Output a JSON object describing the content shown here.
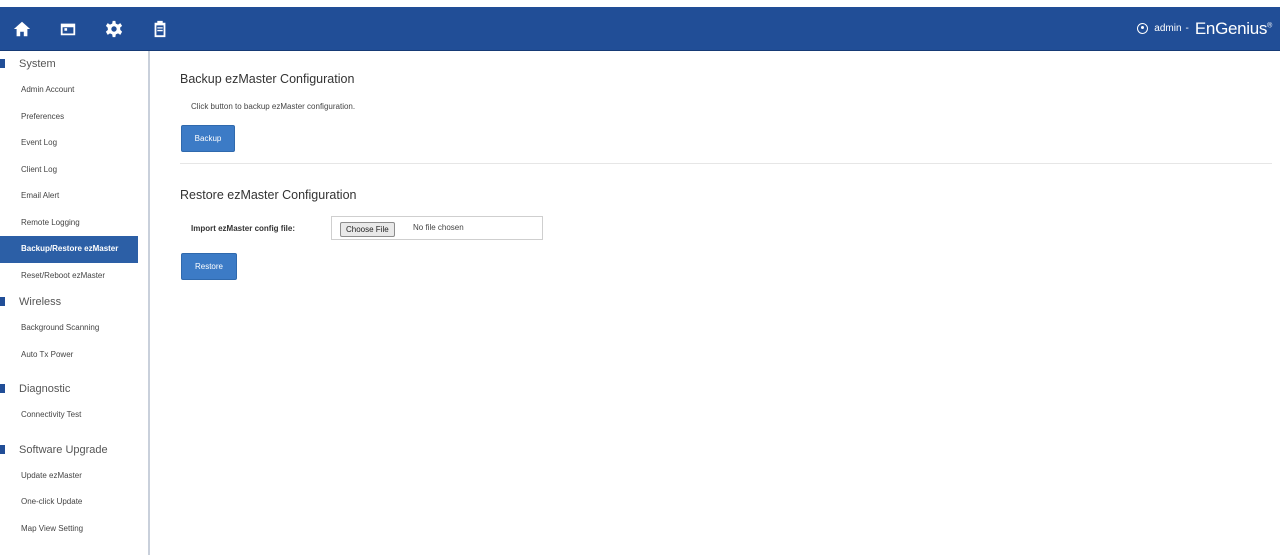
{
  "topbar": {
    "icons": [
      "home-icon",
      "calendar-icon",
      "gear-icon",
      "clipboard-icon"
    ],
    "user": "admin",
    "separator": "-",
    "brand": "EnGenius",
    "brand_mark": "®"
  },
  "sidebar": {
    "sections": [
      {
        "label": "System",
        "items": [
          "Admin Account",
          "Preferences",
          "Event Log",
          "Client Log",
          "Email Alert",
          "Remote Logging",
          "Backup/Restore ezMaster",
          "Reset/Reboot ezMaster"
        ]
      },
      {
        "label": "Wireless",
        "items": [
          "Background Scanning",
          "Auto Tx Power"
        ]
      },
      {
        "label": "Diagnostic",
        "items": [
          "Connectivity Test"
        ]
      },
      {
        "label": "Software Upgrade",
        "items": [
          "Update ezMaster",
          "One-click Update",
          "Map View Setting"
        ]
      }
    ],
    "active_item": "Backup/Restore ezMaster"
  },
  "backup": {
    "title": "Backup ezMaster Configuration",
    "description": "Click button to backup ezMaster configuration.",
    "button_label": "Backup"
  },
  "restore": {
    "title": "Restore ezMaster Configuration",
    "import_label": "Import ezMaster config file:",
    "choose_file_label": "Choose File",
    "file_status": "No file chosen",
    "button_label": "Restore"
  },
  "colors": {
    "header_blue": "#214e97",
    "active_item_blue": "#2c5fa6",
    "button_blue": "#3c7bc6"
  }
}
